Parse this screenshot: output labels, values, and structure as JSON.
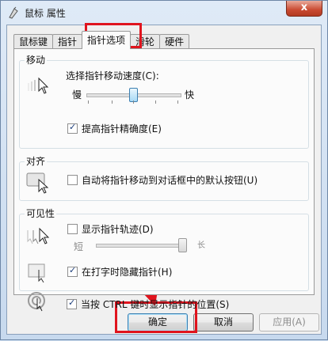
{
  "window": {
    "title": "鼠标 属性",
    "close_label": "x"
  },
  "tabs": [
    {
      "label": "鼠标键",
      "active": false
    },
    {
      "label": "指针",
      "active": false
    },
    {
      "label": "指针选项",
      "active": true
    },
    {
      "label": "滑轮",
      "active": false
    },
    {
      "label": "硬件",
      "active": false
    }
  ],
  "motion": {
    "title": "移动",
    "speed_label": "选择指针移动速度(C):",
    "slow_label": "慢",
    "fast_label": "快",
    "speed_level": 0.45,
    "precision_label": "提高指针精确度(E)",
    "precision_checked": true
  },
  "snap": {
    "title": "对齐",
    "label": "自动将指针移动到对话框中的默认按钮(U)",
    "checked": false
  },
  "visibility": {
    "title": "可见性",
    "trails_label": "显示指针轨迹(D)",
    "trails_checked": false,
    "short_label": "短",
    "long_label": "长",
    "trails_level": 1.0,
    "hide_label": "在打字时隐藏指针(H)",
    "hide_checked": true,
    "ctrl_label": "当按 CTRL 键时显示指针的位置(S)",
    "ctrl_checked": true
  },
  "buttons": {
    "ok": "确定",
    "cancel": "取消",
    "apply": "应用(A)"
  },
  "colors": {
    "annotation": "#e0141e"
  }
}
